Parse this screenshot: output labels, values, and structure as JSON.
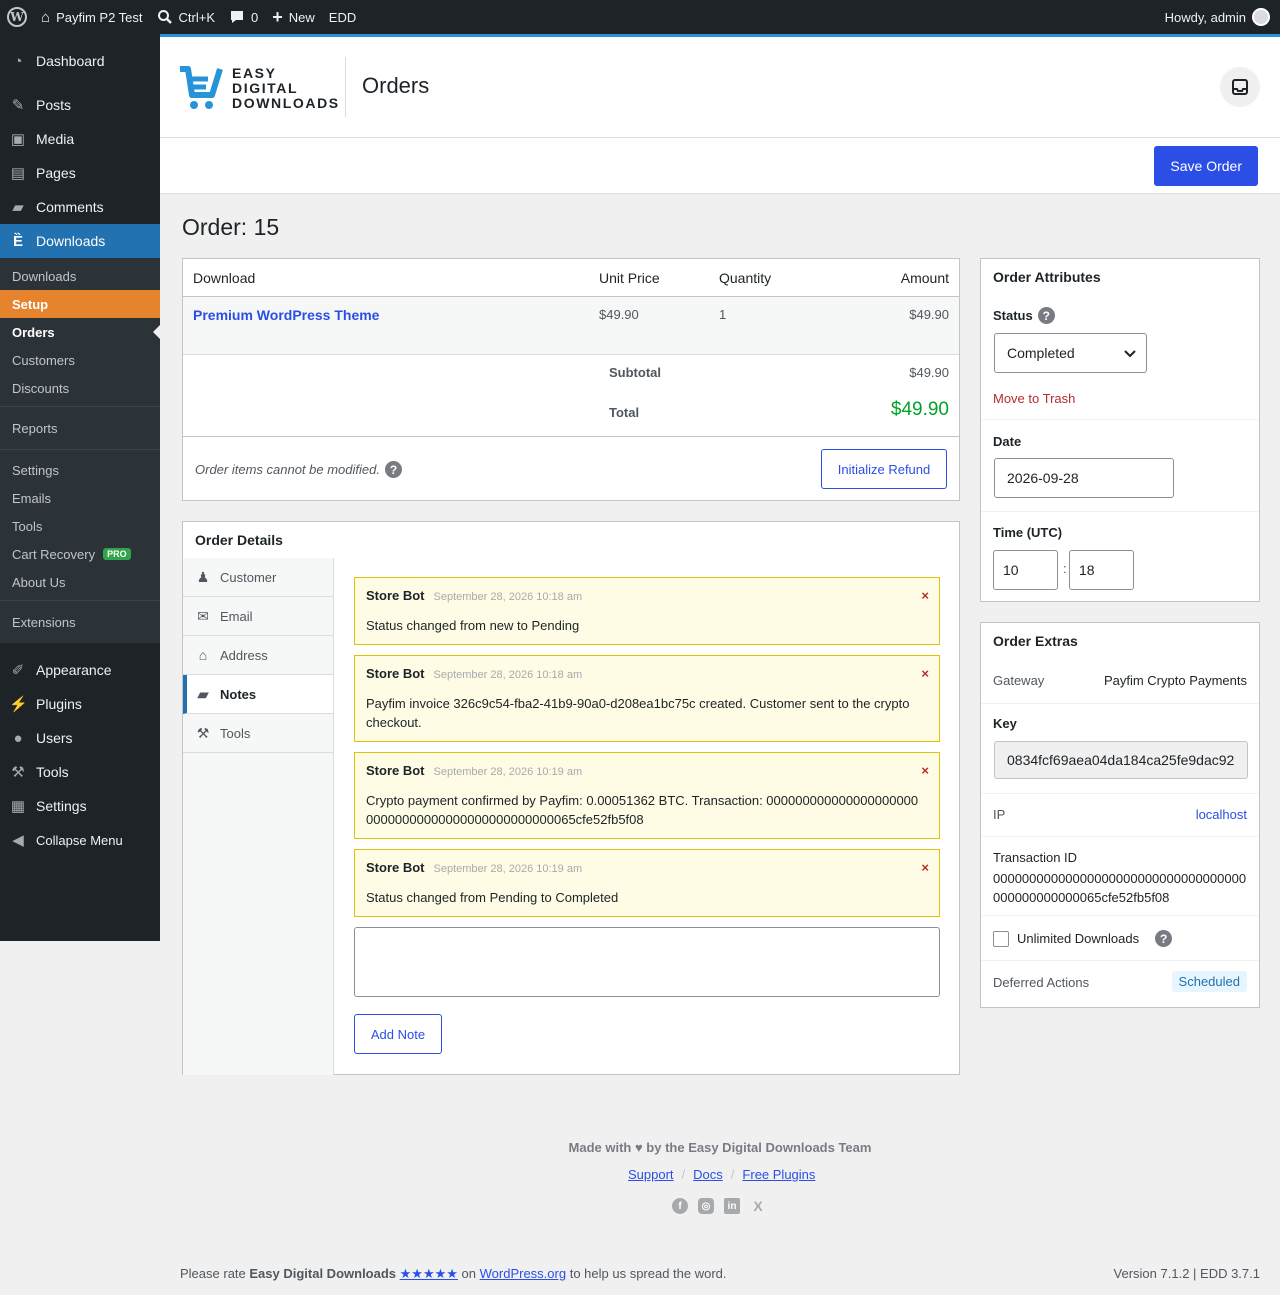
{
  "adminbar": {
    "site_name": "Payfim P2 Test",
    "search_shortcut": "Ctrl+K",
    "comments_count": "0",
    "new_label": "New",
    "edd_label": "EDD",
    "howdy": "Howdy, admin"
  },
  "sidebar": {
    "top_items": [
      {
        "label": "Dashboard",
        "icon": "dashboard-icon"
      },
      {
        "label": "Posts",
        "icon": "pushpin-icon"
      },
      {
        "label": "Media",
        "icon": "media-icon"
      },
      {
        "label": "Pages",
        "icon": "pages-icon"
      },
      {
        "label": "Comments",
        "icon": "comment-icon"
      },
      {
        "label": "Downloads",
        "icon": "edd-cart-icon"
      }
    ],
    "sub_items": [
      "Downloads",
      "Setup",
      "Orders",
      "Customers",
      "Discounts",
      "Reports",
      "Settings",
      "Emails",
      "Tools",
      "Cart Recovery",
      "About Us",
      "Extensions"
    ],
    "pro_badge": "PRO",
    "bottom_items": [
      {
        "label": "Appearance",
        "icon": "brush-icon"
      },
      {
        "label": "Plugins",
        "icon": "plugin-icon"
      },
      {
        "label": "Users",
        "icon": "users-icon"
      },
      {
        "label": "Tools",
        "icon": "wrench-icon"
      },
      {
        "label": "Settings",
        "icon": "settings-icon"
      },
      {
        "label": "Collapse Menu",
        "icon": "collapse-icon"
      }
    ]
  },
  "header": {
    "logo_line1": "EASY",
    "logo_line2": "DIGITAL",
    "logo_line3": "DOWNLOADS",
    "page_title": "Orders"
  },
  "toolbar": {
    "save_label": "Save Order"
  },
  "order": {
    "title": "Order: 15",
    "columns": [
      "Download",
      "Unit Price",
      "Quantity",
      "Amount"
    ],
    "items": [
      {
        "name": "Premium WordPress Theme",
        "unit_price": "$49.90",
        "quantity": "1",
        "amount": "$49.90"
      }
    ],
    "subtotal_label": "Subtotal",
    "subtotal": "$49.90",
    "total_label": "Total",
    "total": "$49.90",
    "locked_note": "Order items cannot be modified.",
    "refund_label": "Initialize Refund"
  },
  "details": {
    "title": "Order Details",
    "tabs": [
      {
        "label": "Customer",
        "icon": "customer-icon"
      },
      {
        "label": "Email",
        "icon": "email-icon"
      },
      {
        "label": "Address",
        "icon": "address-icon"
      },
      {
        "label": "Notes",
        "icon": "notes-icon"
      },
      {
        "label": "Tools",
        "icon": "tools-icon"
      }
    ],
    "notes": [
      {
        "author": "Store Bot",
        "date": "September 28, 2026 10:18 am",
        "text": "Status changed from new to Pending"
      },
      {
        "author": "Store Bot",
        "date": "September 28, 2026 10:18 am",
        "text": "Payfim invoice 326c9c54-fba2-41b9-90a0-d208ea1bc75c created. Customer sent to the crypto checkout."
      },
      {
        "author": "Store Bot",
        "date": "September 28, 2026 10:19 am",
        "text": "Crypto payment confirmed by Payfim: 0.00051362 BTC. Transaction: 00000000000000000000000000000000000000000000000065cfe52fb5f08"
      },
      {
        "author": "Store Bot",
        "date": "September 28, 2026 10:19 am",
        "text": "Status changed from Pending to Completed"
      }
    ],
    "delete_glyph": "×",
    "add_note_label": "Add Note"
  },
  "attributes": {
    "title": "Order Attributes",
    "status_label": "Status",
    "status_value": "Completed",
    "trash_label": "Move to Trash",
    "date_label": "Date",
    "date_value": "2026-09-28",
    "time_label": "Time (UTC)",
    "hour": "10",
    "minute": "18",
    "time_sep": ":"
  },
  "extras": {
    "title": "Order Extras",
    "gateway_label": "Gateway",
    "gateway_value": "Payfim Crypto Payments",
    "key_label": "Key",
    "key_value": "0834fcf69aea04da184ca25fe9dac92",
    "ip_label": "IP",
    "ip_value": "localhost",
    "txn_label": "Transaction ID",
    "txn_value": "00000000000000000000000000000000000000000000000065cfe52fb5f08",
    "unlimited_label": "Unlimited Downloads",
    "deferred_label": "Deferred Actions",
    "deferred_value": "Scheduled"
  },
  "footer": {
    "made_with": "Made with ♥ by the Easy Digital Downloads Team",
    "links": [
      "Support",
      "Docs",
      "Free Plugins"
    ],
    "link_sep": "/",
    "rate_prefix": "Please rate ",
    "rate_plugin": "Easy Digital Downloads",
    "rate_stars": "★★★★★",
    "rate_on": " on ",
    "rate_site": "WordPress.org",
    "rate_suffix": " to help us spread the word.",
    "version": "Version 7.1.2 | EDD 3.7.1"
  },
  "colors": {
    "accent": "#2b4ee6",
    "admin_dark": "#1d2327",
    "setup_orange": "#e5842d",
    "total_green": "#00a32a",
    "trash_red": "#b32d2e",
    "note_bg": "#fefce5",
    "note_border": "#dbc40a"
  }
}
